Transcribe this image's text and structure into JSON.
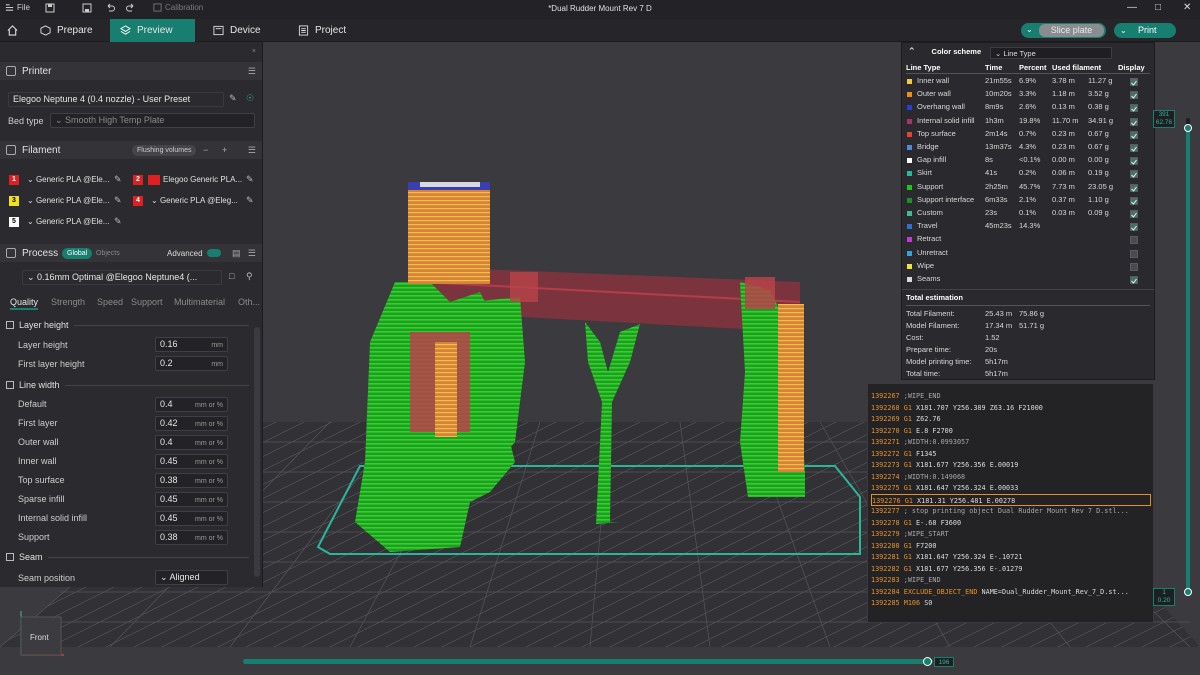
{
  "titlebar": {
    "file_label": "File",
    "calibration_label": "Calibration",
    "window_title": "*Dual Rudder Mount Rev 7 D"
  },
  "tabs": [
    {
      "label": "Prepare"
    },
    {
      "label": "Preview"
    },
    {
      "label": "Device"
    },
    {
      "label": "Project"
    }
  ],
  "actions": {
    "slice_label": "Slice plate",
    "print_label": "Print"
  },
  "printer": {
    "section_label": "Printer",
    "preset": "Elegoo Neptune 4 (0.4 nozzle) - User Preset",
    "bed_type_label": "Bed type",
    "bed_type_value": "Smooth High Temp Plate"
  },
  "filament": {
    "section_label": "Filament",
    "flushing_label": "Flushing volumes",
    "slots": [
      {
        "num": "1",
        "name": "Generic PLA @Ele...",
        "color": "#e02020"
      },
      {
        "num": "2",
        "name": "Elegoo Generic PLA...",
        "color": "#e02020"
      },
      {
        "num": "3",
        "name": "Generic PLA @Ele...",
        "color": "#f0e020"
      },
      {
        "num": "4",
        "name": "Generic PLA @Eleg...",
        "color": "#e02020"
      },
      {
        "num": "5",
        "name": "Generic PLA @Ele...",
        "color": "#ffffff"
      }
    ]
  },
  "process": {
    "section_label": "Process",
    "global_label": "Global",
    "objects_label": "Objects",
    "advanced_label": "Advanced",
    "preset": "0.16mm Optimal @Elegoo Neptune4 (...",
    "subtabs": [
      "Quality",
      "Strength",
      "Speed",
      "Support",
      "Multimaterial",
      "Oth..."
    ]
  },
  "quality": {
    "layer_height_group": "Layer height",
    "layer_height_label": "Layer height",
    "layer_height_value": "0.16",
    "first_layer_height_label": "First layer height",
    "first_layer_height_value": "0.2",
    "line_width_group": "Line width",
    "mm": "mm",
    "mm_or_pct": "mm or %",
    "line_widths": [
      {
        "label": "Default",
        "value": "0.4"
      },
      {
        "label": "First layer",
        "value": "0.42"
      },
      {
        "label": "Outer wall",
        "value": "0.4"
      },
      {
        "label": "Inner wall",
        "value": "0.45"
      },
      {
        "label": "Top surface",
        "value": "0.38"
      },
      {
        "label": "Sparse infill",
        "value": "0.45"
      },
      {
        "label": "Internal solid infill",
        "value": "0.45"
      },
      {
        "label": "Support",
        "value": "0.38"
      }
    ],
    "seam_group": "Seam",
    "seam_position_label": "Seam position",
    "seam_position_value": "Aligned"
  },
  "stats": {
    "color_scheme_label": "Color scheme",
    "color_scheme_value": "Line Type",
    "headers": [
      "Line Type",
      "Time",
      "Percent",
      "Used filament",
      "Display"
    ],
    "rows": [
      {
        "name": "Inner wall",
        "color": "#f2c844",
        "time": "21m55s",
        "pct": "6.9%",
        "len": "3.78 m",
        "wt": "11.27 g"
      },
      {
        "name": "Outer wall",
        "color": "#f28a1e",
        "time": "10m20s",
        "pct": "3.3%",
        "len": "1.18 m",
        "wt": "3.52 g"
      },
      {
        "name": "Overhang wall",
        "color": "#2d3bd6",
        "time": "8m9s",
        "pct": "2.6%",
        "len": "0.13 m",
        "wt": "0.38 g"
      },
      {
        "name": "Internal solid infill",
        "color": "#a8336c",
        "time": "1h3m",
        "pct": "19.8%",
        "len": "11.70 m",
        "wt": "34.91 g"
      },
      {
        "name": "Top surface",
        "color": "#e8412f",
        "time": "2m14s",
        "pct": "0.7%",
        "len": "0.23 m",
        "wt": "0.67 g"
      },
      {
        "name": "Bridge",
        "color": "#4f8ad8",
        "time": "13m37s",
        "pct": "4.3%",
        "len": "0.23 m",
        "wt": "0.67 g"
      },
      {
        "name": "Gap infill",
        "color": "#ffffff",
        "time": "8s",
        "pct": "<0.1%",
        "len": "0.00 m",
        "wt": "0.00 g"
      },
      {
        "name": "Skirt",
        "color": "#2bb59b",
        "time": "41s",
        "pct": "0.2%",
        "len": "0.06 m",
        "wt": "0.19 g"
      },
      {
        "name": "Support",
        "color": "#25c21d",
        "time": "2h25m",
        "pct": "45.7%",
        "len": "7.73 m",
        "wt": "23.05 g"
      },
      {
        "name": "Support interface",
        "color": "#1e8f28",
        "time": "6m33s",
        "pct": "2.1%",
        "len": "0.37 m",
        "wt": "1.10 g"
      },
      {
        "name": "Custom",
        "color": "#42b896",
        "time": "23s",
        "pct": "0.1%",
        "len": "0.03 m",
        "wt": "0.09 g"
      },
      {
        "name": "Travel",
        "color": "#2e6fd6",
        "time": "45m23s",
        "pct": "14.3%",
        "len": "",
        "wt": ""
      },
      {
        "name": "Retract",
        "color": "#c13ad6",
        "time": "",
        "pct": "",
        "len": "",
        "wt": ""
      },
      {
        "name": "Unretract",
        "color": "#3a9fd6",
        "time": "",
        "pct": "",
        "len": "",
        "wt": ""
      },
      {
        "name": "Wipe",
        "color": "#f2e13a",
        "time": "",
        "pct": "",
        "len": "",
        "wt": ""
      },
      {
        "name": "Seams",
        "color": "#d9d9d9",
        "time": "",
        "pct": "",
        "len": "",
        "wt": ""
      }
    ],
    "estimation_label": "Total estimation",
    "estimation": [
      {
        "label": "Total Filament:",
        "v1": "25.43 m",
        "v2": "75.86 g"
      },
      {
        "label": "Model Filament:",
        "v1": "17.34 m",
        "v2": "51.71 g"
      },
      {
        "label": "Cost:",
        "v1": "1.52",
        "v2": ""
      },
      {
        "label": "Prepare time:",
        "v1": "20s",
        "v2": ""
      },
      {
        "label": "Model printing time:",
        "v1": "5h17m",
        "v2": ""
      },
      {
        "label": "Total time:",
        "v1": "5h17m",
        "v2": ""
      }
    ]
  },
  "gcode": [
    {
      "n": "1392267",
      "k": "",
      "t": ";WIPE_END",
      "c": true
    },
    {
      "n": "1392268",
      "k": "G1",
      "t": "X181.707 Y256.389 Z63.16 F21000",
      "c": false
    },
    {
      "n": "1392269",
      "k": "G1",
      "t": "Z62.76",
      "c": false
    },
    {
      "n": "1392270",
      "k": "G1",
      "t": "E.8 F2700",
      "c": false
    },
    {
      "n": "1392271",
      "k": "",
      "t": ";WIDTH:0.0993057",
      "c": true
    },
    {
      "n": "1392272",
      "k": "G1",
      "t": "F1345",
      "c": false
    },
    {
      "n": "1392273",
      "k": "G1",
      "t": "X181.677 Y256.356 E.00019",
      "c": false
    },
    {
      "n": "1392274",
      "k": "",
      "t": ";WIDTH:0.149068",
      "c": true
    },
    {
      "n": "1392275",
      "k": "G1",
      "t": "X181.647 Y256.324 E.00033",
      "c": false
    },
    {
      "n": "1392276",
      "k": "G1",
      "t": "X181.31 Y256.481 E.00278",
      "c": false
    },
    {
      "n": "1392277",
      "k": "",
      "t": "; stop printing object Dual Rudder Mount Rev 7 D.stl...",
      "c": true
    },
    {
      "n": "1392278",
      "k": "G1",
      "t": "E-.68 F3600",
      "c": false
    },
    {
      "n": "1392279",
      "k": "",
      "t": ";WIPE_START",
      "c": true
    },
    {
      "n": "1392280",
      "k": "G1",
      "t": "F7200",
      "c": false
    },
    {
      "n": "1392281",
      "k": "G1",
      "t": "X181.647 Y256.324 E-.10721",
      "c": false
    },
    {
      "n": "1392282",
      "k": "G1",
      "t": "X181.677 Y256.356 E-.01279",
      "c": false
    },
    {
      "n": "1392283",
      "k": "",
      "t": ";WIPE_END",
      "c": true
    },
    {
      "n": "1392284",
      "k": "EXCLUDE_OBJECT_END",
      "t": "NAME=Dual_Rudder_Mount_Rev_7_D.st...",
      "c": false
    },
    {
      "n": "1392285",
      "k": "M106",
      "t": "S0",
      "c": false
    }
  ],
  "gcode_highlight_index": 9,
  "vslider": {
    "top_layer": "391",
    "top_height": "62.76",
    "bottom_layer": "1",
    "bottom_height": "0.20"
  },
  "hslider": {
    "value": "196"
  },
  "navcube": {
    "label": "Front"
  }
}
